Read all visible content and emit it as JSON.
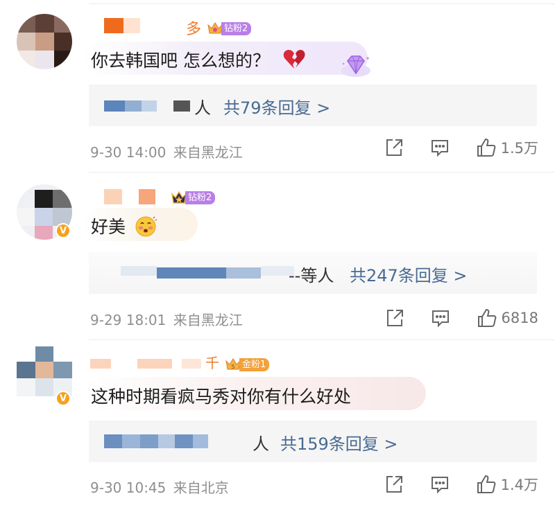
{
  "comments": [
    {
      "username_tail": "多",
      "fan_badge": "钻粉2",
      "text": "你去韩国吧 怎么想的？",
      "reply_suffix": "人",
      "reply_more": "共79条回复 >",
      "timestamp": "9-30 14:00",
      "location": "来自黑龙江",
      "likes": "1.5万",
      "accent_color": "#f07a2a"
    },
    {
      "username_tail": "",
      "fan_badge": "钻粉2",
      "text": "好美",
      "reply_suffix": "--等人",
      "reply_more": "共247条回复 >",
      "timestamp": "9-29 18:01",
      "location": "来自黑龙江",
      "likes": "6818",
      "verified_badge": "V"
    },
    {
      "username_tail": "千",
      "fan_badge": "金粉1",
      "text": "这种时期看疯马秀对你有什么好处",
      "reply_suffix": "人",
      "reply_more": "共159条回复 >",
      "timestamp": "9-30 10:45",
      "location": "来自北京",
      "likes": "1.4万",
      "verified_badge": "V"
    }
  ],
  "icons": {
    "share": "share-icon",
    "comment": "comment-icon",
    "like": "thumbs-up-icon",
    "broken_heart": "broken-heart-icon",
    "diamond": "diamond-icon",
    "emoji": "blush-emoji-icon",
    "crown": "crown-icon"
  },
  "colors": {
    "link": "#486a93",
    "meta": "#8f8f8f",
    "diamond_badge": "#b87fe6",
    "gold_badge": "#f2a13b",
    "verified": "#f7a11b"
  }
}
